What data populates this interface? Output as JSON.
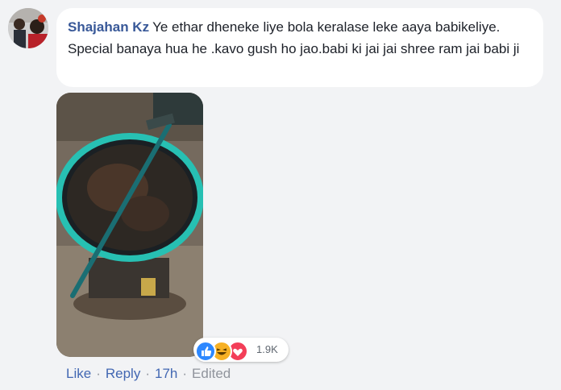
{
  "comment": {
    "author": "Shajahan Kz",
    "text": "Ye ethar dheneke liye bola keralase leke aaya babikeliye. Special banaya hua he .kavo gush ho jao.babi ki jai jai shree ram jai babi ji"
  },
  "reactions": {
    "icons": [
      "like-icon",
      "haha-icon",
      "love-icon"
    ],
    "count": "1.9K"
  },
  "actions": {
    "like": "Like",
    "reply": "Reply",
    "time": "17h",
    "edited": "Edited",
    "separator": "·"
  },
  "colors": {
    "author": "#385898",
    "link": "#4267b2",
    "muted": "#90949c",
    "like": "#2d88ff",
    "haha": "#f7b125",
    "love": "#f33e58"
  }
}
